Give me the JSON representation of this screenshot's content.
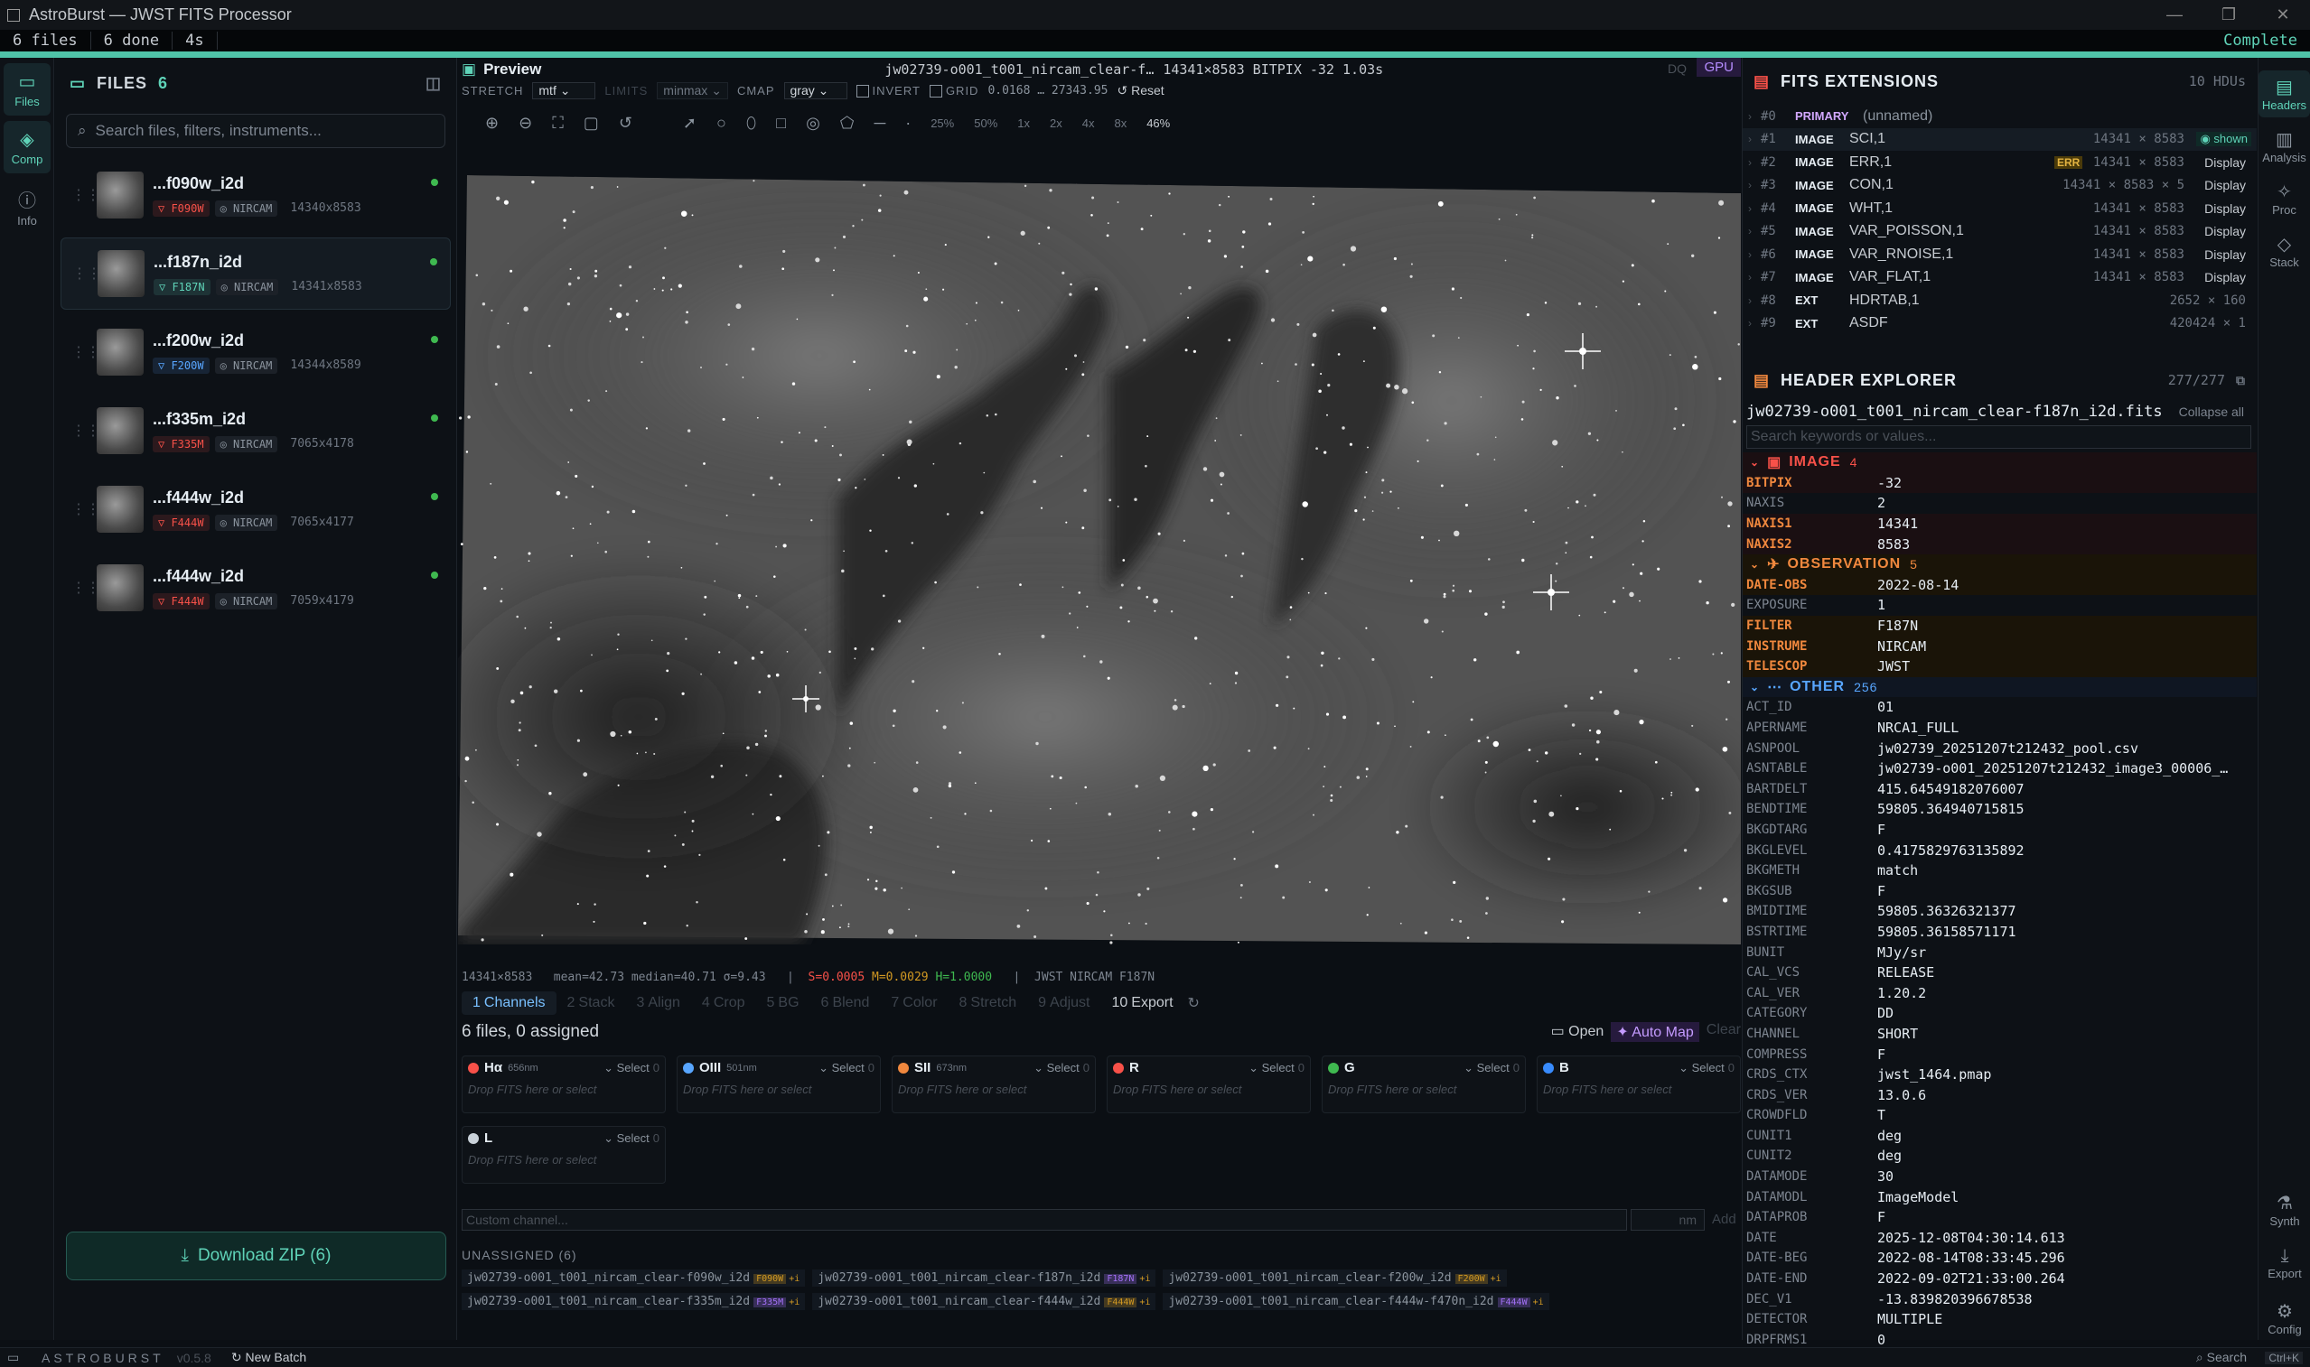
{
  "window": {
    "title": "AstroBurst — JWST FITS Processor"
  },
  "status": {
    "files": "6 files",
    "done": "6 done",
    "time": "4s",
    "state": "Complete",
    "progress": 1.0
  },
  "rail_left": [
    {
      "label": "Files",
      "icon": "folder-icon"
    },
    {
      "label": "Comp",
      "icon": "layers-icon"
    },
    {
      "label": "Info",
      "icon": "info-icon"
    }
  ],
  "files_panel": {
    "title": "FILES",
    "count": "6",
    "search_placeholder": "Search files, filters, instruments...",
    "items": [
      {
        "name": "...f090w_i2d",
        "filter": "F090W",
        "instrument": "NIRCAM",
        "dims": "14340x8583",
        "filter_color": "#f85149"
      },
      {
        "name": "...f187n_i2d",
        "filter": "F187N",
        "instrument": "NIRCAM",
        "dims": "14341x8583",
        "filter_color": "#5fd3b8"
      },
      {
        "name": "...f200w_i2d",
        "filter": "F200W",
        "instrument": "NIRCAM",
        "dims": "14344x8589",
        "filter_color": "#58a6ff"
      },
      {
        "name": "...f335m_i2d",
        "filter": "F335M",
        "instrument": "NIRCAM",
        "dims": "7065x4178",
        "filter_color": "#f85149"
      },
      {
        "name": "...f444w_i2d",
        "filter": "F444W",
        "instrument": "NIRCAM",
        "dims": "7065x4177",
        "filter_color": "#f85149"
      },
      {
        "name": "...f444w_i2d",
        "filter": "F444W",
        "instrument": "NIRCAM",
        "dims": "7059x4179",
        "filter_color": "#f85149"
      }
    ],
    "download_label": "Download ZIP (6)"
  },
  "preview": {
    "title": "Preview",
    "filename": "jw02739-o001_t001_nircam_clear-f…",
    "meta": "14341×8583 BITPIX -32 1.03s",
    "dq": "DQ",
    "gpu": "GPU",
    "stretch_label": "STRETCH",
    "stretch_value": "mtf",
    "limits_label": "LIMITS",
    "limits_value": "minmax",
    "cmap_label": "CMAP",
    "cmap_value": "gray",
    "invert_label": "INVERT",
    "grid_label": "GRID",
    "range": "0.0168 … 27343.95",
    "reset": "Reset",
    "zooms": [
      "25%",
      "50%",
      "1x",
      "2x",
      "4x",
      "8x"
    ],
    "zoom_current": "46%",
    "stats_dims": "14341×8583",
    "stats": "mean=42.73 median=40.71 σ=9.43",
    "s_val": "S=0.0005",
    "m_val": "M=0.0029",
    "h_val": "H=1.0000",
    "tags": "JWST NIRCAM F187N"
  },
  "steps": [
    {
      "n": "1",
      "label": "Channels",
      "state": "active"
    },
    {
      "n": "2",
      "label": "Stack",
      "state": "dim"
    },
    {
      "n": "3",
      "label": "Align",
      "state": "dim"
    },
    {
      "n": "4",
      "label": "Crop",
      "state": "dim"
    },
    {
      "n": "5",
      "label": "BG",
      "state": "dim"
    },
    {
      "n": "6",
      "label": "Blend",
      "state": "dim"
    },
    {
      "n": "7",
      "label": "Color",
      "state": "dim"
    },
    {
      "n": "8",
      "label": "Stretch",
      "state": "dim"
    },
    {
      "n": "9",
      "label": "Adjust",
      "state": "dim"
    },
    {
      "n": "10",
      "label": "Export",
      "state": "on"
    }
  ],
  "channels": {
    "assigned_text": "6 files, 0 assigned",
    "open": "Open",
    "automap": "Auto Map",
    "clear": "Clear",
    "list": [
      {
        "name": "Hα",
        "wl": "656nm",
        "color": "#f85149",
        "select": "Select",
        "n": "0",
        "drop": "Drop FITS here or select"
      },
      {
        "name": "OIII",
        "wl": "501nm",
        "color": "#58a6ff",
        "select": "Select",
        "n": "0",
        "drop": "Drop FITS here or select"
      },
      {
        "name": "SII",
        "wl": "673nm",
        "color": "#f0883e",
        "select": "Select",
        "n": "0",
        "drop": "Drop FITS here or select"
      },
      {
        "name": "R",
        "wl": "",
        "color": "#f85149",
        "select": "Select",
        "n": "0",
        "drop": "Drop FITS here or select"
      },
      {
        "name": "G",
        "wl": "",
        "color": "#3fb950",
        "select": "Select",
        "n": "0",
        "drop": "Drop FITS here or select"
      },
      {
        "name": "B",
        "wl": "",
        "color": "#388bfd",
        "select": "Select",
        "n": "0",
        "drop": "Drop FITS here or select"
      },
      {
        "name": "L",
        "wl": "",
        "color": "#c9d1d9",
        "select": "Select",
        "n": "0",
        "drop": "Drop FITS here or select"
      }
    ],
    "custom_placeholder": "Custom channel...",
    "nm_placeholder": "nm",
    "add": "Add",
    "unassigned_label": "UNASSIGNED (6)",
    "unassigned": [
      {
        "name": "jw02739-o001_t001_nircam_clear-f090w_i2d",
        "badge": "F090W",
        "color": "#d29922"
      },
      {
        "name": "jw02739-o001_t001_nircam_clear-f187n_i2d",
        "badge": "F187N",
        "color": "#a371f7"
      },
      {
        "name": "jw02739-o001_t001_nircam_clear-f200w_i2d",
        "badge": "F200W",
        "color": "#d29922"
      },
      {
        "name": "jw02739-o001_t001_nircam_clear-f335m_i2d",
        "badge": "F335M",
        "color": "#a371f7"
      },
      {
        "name": "jw02739-o001_t001_nircam_clear-f444w_i2d",
        "badge": "F444W",
        "color": "#d29922"
      },
      {
        "name": "jw02739-o001_t001_nircam_clear-f444w-f470n_i2d",
        "badge": "F444W",
        "color": "#a371f7"
      }
    ]
  },
  "extensions": {
    "title": "FITS EXTENSIONS",
    "count": "10 HDUs",
    "rows": [
      {
        "idx": "#0",
        "type": "PRIMARY",
        "name": "(unnamed)",
        "dims": "",
        "action": ""
      },
      {
        "idx": "#1",
        "type": "IMAGE",
        "name": "SCI,1",
        "dims": "14341 × 8583",
        "action": "shown"
      },
      {
        "idx": "#2",
        "type": "IMAGE",
        "name": "ERR,1",
        "dims": "14341 × 8583",
        "action": "Display",
        "err": "ERR"
      },
      {
        "idx": "#3",
        "type": "IMAGE",
        "name": "CON,1",
        "dims": "14341 × 8583 × 5",
        "action": "Display"
      },
      {
        "idx": "#4",
        "type": "IMAGE",
        "name": "WHT,1",
        "dims": "14341 × 8583",
        "action": "Display"
      },
      {
        "idx": "#5",
        "type": "IMAGE",
        "name": "VAR_POISSON,1",
        "dims": "14341 × 8583",
        "action": "Display"
      },
      {
        "idx": "#6",
        "type": "IMAGE",
        "name": "VAR_RNOISE,1",
        "dims": "14341 × 8583",
        "action": "Display"
      },
      {
        "idx": "#7",
        "type": "IMAGE",
        "name": "VAR_FLAT,1",
        "dims": "14341 × 8583",
        "action": "Display"
      },
      {
        "idx": "#8",
        "type": "EXT",
        "name": "HDRTAB,1",
        "dims": "2652 × 160",
        "action": ""
      },
      {
        "idx": "#9",
        "type": "EXT",
        "name": "ASDF",
        "dims": "420424 × 1",
        "action": ""
      }
    ]
  },
  "header_explorer": {
    "title": "HEADER EXPLORER",
    "count": "277/277",
    "file": "jw02739-o001_t001_nircam_clear-f187n_i2d.fits",
    "collapse": "Collapse all",
    "search_placeholder": "Search keywords or values...",
    "groups": {
      "image": {
        "label": "IMAGE",
        "count": "4",
        "rows": [
          {
            "k": "BITPIX",
            "v": "-32",
            "hl": true
          },
          {
            "k": "NAXIS",
            "v": "2",
            "hl": false
          },
          {
            "k": "NAXIS1",
            "v": "14341",
            "hl": true
          },
          {
            "k": "NAXIS2",
            "v": "8583",
            "hl": true
          }
        ]
      },
      "observation": {
        "label": "OBSERVATION",
        "count": "5",
        "rows": [
          {
            "k": "DATE-OBS",
            "v": "2022-08-14",
            "hl": true
          },
          {
            "k": "EXPOSURE",
            "v": "1",
            "hl": false
          },
          {
            "k": "FILTER",
            "v": "F187N",
            "hl": true
          },
          {
            "k": "INSTRUME",
            "v": "NIRCAM",
            "hl": true
          },
          {
            "k": "TELESCOP",
            "v": "JWST",
            "hl": true
          }
        ]
      },
      "other": {
        "label": "OTHER",
        "count": "256",
        "rows": [
          {
            "k": "ACT_ID",
            "v": "01"
          },
          {
            "k": "APERNAME",
            "v": "NRCA1_FULL"
          },
          {
            "k": "ASNPOOL",
            "v": "jw02739_20251207t212432_pool.csv"
          },
          {
            "k": "ASNTABLE",
            "v": "jw02739-o001_20251207t212432_image3_00006_…"
          },
          {
            "k": "BARTDELT",
            "v": "415.64549182076007"
          },
          {
            "k": "BENDTIME",
            "v": "59805.364940715815"
          },
          {
            "k": "BKGDTARG",
            "v": "F"
          },
          {
            "k": "BKGLEVEL",
            "v": "0.4175829763135892"
          },
          {
            "k": "BKGMETH",
            "v": "match"
          },
          {
            "k": "BKGSUB",
            "v": "F"
          },
          {
            "k": "BMIDTIME",
            "v": "59805.36326321377"
          },
          {
            "k": "BSTRTIME",
            "v": "59805.36158571171"
          },
          {
            "k": "BUNIT",
            "v": "MJy/sr"
          },
          {
            "k": "CAL_VCS",
            "v": "RELEASE"
          },
          {
            "k": "CAL_VER",
            "v": "1.20.2"
          },
          {
            "k": "CATEGORY",
            "v": "DD"
          },
          {
            "k": "CHANNEL",
            "v": "SHORT"
          },
          {
            "k": "COMPRESS",
            "v": "F"
          },
          {
            "k": "CRDS_CTX",
            "v": "jwst_1464.pmap"
          },
          {
            "k": "CRDS_VER",
            "v": "13.0.6"
          },
          {
            "k": "CROWDFLD",
            "v": "T"
          },
          {
            "k": "CUNIT1",
            "v": "deg"
          },
          {
            "k": "CUNIT2",
            "v": "deg"
          },
          {
            "k": "DATAMODE",
            "v": "30"
          },
          {
            "k": "DATAMODL",
            "v": "ImageModel"
          },
          {
            "k": "DATAPROB",
            "v": "F"
          },
          {
            "k": "DATE",
            "v": "2025-12-08T04:30:14.613"
          },
          {
            "k": "DATE-BEG",
            "v": "2022-08-14T08:33:45.296"
          },
          {
            "k": "DATE-END",
            "v": "2022-09-02T21:33:00.264"
          },
          {
            "k": "DEC_V1",
            "v": "-13.839820396678538"
          },
          {
            "k": "DETECTOR",
            "v": "MULTIPLE"
          },
          {
            "k": "DRPFRMS1",
            "v": "0"
          }
        ]
      }
    }
  },
  "rail_right": [
    {
      "label": "Headers",
      "icon": "document-icon"
    },
    {
      "label": "Analysis",
      "icon": "bar-chart-icon"
    },
    {
      "label": "Proc",
      "icon": "wand-icon"
    },
    {
      "label": "Stack",
      "icon": "stack-icon"
    },
    {
      "label": "Synth",
      "icon": "flask-icon"
    },
    {
      "label": "Export",
      "icon": "download-icon"
    },
    {
      "label": "Config",
      "icon": "gear-icon"
    }
  ],
  "footer": {
    "brand": "ASTROBURST",
    "version": "v0.5.8",
    "new_batch": "New Batch",
    "search": "Search",
    "shortcut": "Ctrl+K"
  }
}
